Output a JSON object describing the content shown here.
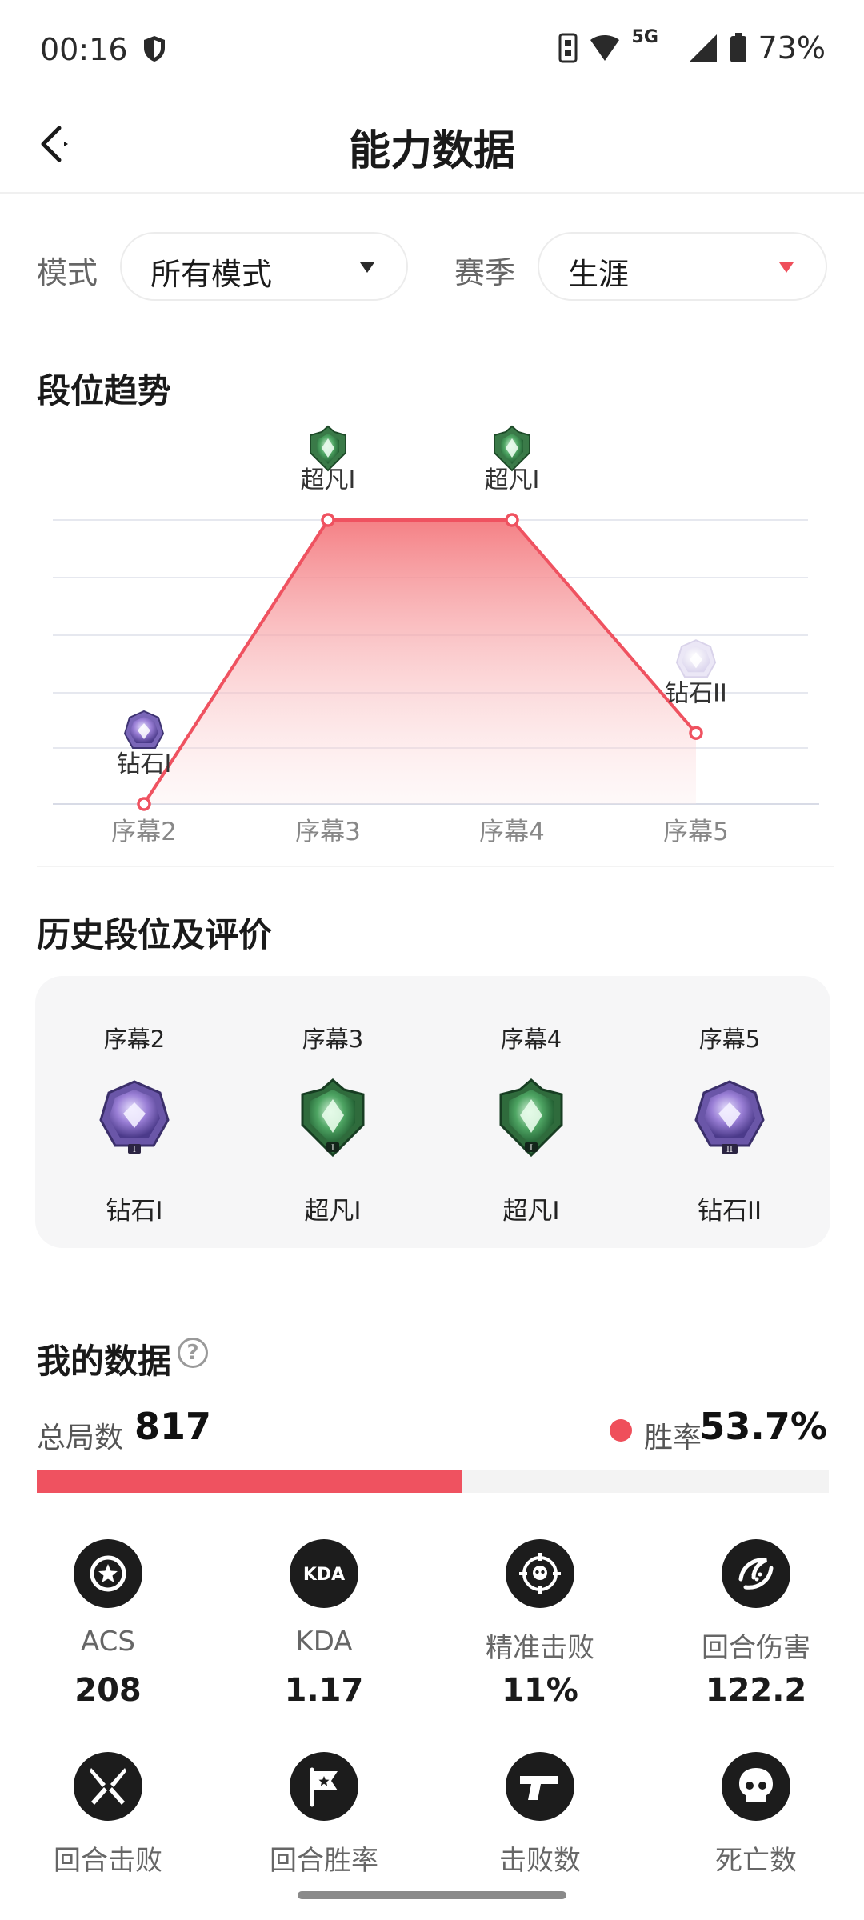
{
  "status_bar": {
    "time": "00:16",
    "network": "5G",
    "battery": "73%",
    "icons": [
      "shield-icon",
      "nfc-icon",
      "wifi-icon",
      "signal-icon",
      "battery-icon"
    ]
  },
  "header": {
    "title": "能力数据",
    "back_icon": "back-arrow-icon"
  },
  "filters": {
    "mode_label": "模式",
    "mode_value": "所有模式",
    "season_label": "赛季",
    "season_value": "生涯"
  },
  "trend": {
    "title": "段位趋势"
  },
  "chart_data": {
    "type": "line",
    "categories": [
      "序幕2",
      "序幕3",
      "序幕4",
      "序幕5"
    ],
    "rank_labels": [
      "钻石I",
      "超凡I",
      "超凡I",
      "钻石II"
    ],
    "values": [
      1,
      5,
      5,
      2
    ],
    "ylim": [
      1,
      5
    ],
    "grid": true,
    "line_color": "#ef5260",
    "fill": "gradient"
  },
  "history": {
    "title": "历史段位及评价",
    "items": [
      {
        "season": "序幕2",
        "rank": "钻石I",
        "badge": "diamond-badge-icon"
      },
      {
        "season": "序幕3",
        "rank": "超凡I",
        "badge": "ascendant-badge-icon"
      },
      {
        "season": "序幕4",
        "rank": "超凡I",
        "badge": "ascendant-badge-icon"
      },
      {
        "season": "序幕5",
        "rank": "钻石II",
        "badge": "diamond-badge-icon"
      }
    ]
  },
  "my_data": {
    "title": "我的数据",
    "help": "?",
    "total_label": "总局数",
    "total_value": "817",
    "win_label": "胜率",
    "win_value": "53.7%",
    "win_rate": 0.537,
    "accent": "#ef5260",
    "stats": [
      {
        "label": "ACS",
        "value": "208",
        "icon": "star-badge-icon"
      },
      {
        "label": "KDA",
        "value": "1.17",
        "icon": "kda-icon",
        "icon_text": "KDA"
      },
      {
        "label": "精准击败",
        "value": "11%",
        "icon": "crosshair-skull-icon"
      },
      {
        "label": "回合伤害",
        "value": "122.2",
        "icon": "damage-icon"
      },
      {
        "label": "回合击败",
        "value": "",
        "icon": "crossed-blades-icon"
      },
      {
        "label": "回合胜率",
        "value": "",
        "icon": "flag-star-icon"
      },
      {
        "label": "击败数",
        "value": "",
        "icon": "pistol-icon"
      },
      {
        "label": "死亡数",
        "value": "",
        "icon": "skull-icon"
      }
    ]
  }
}
